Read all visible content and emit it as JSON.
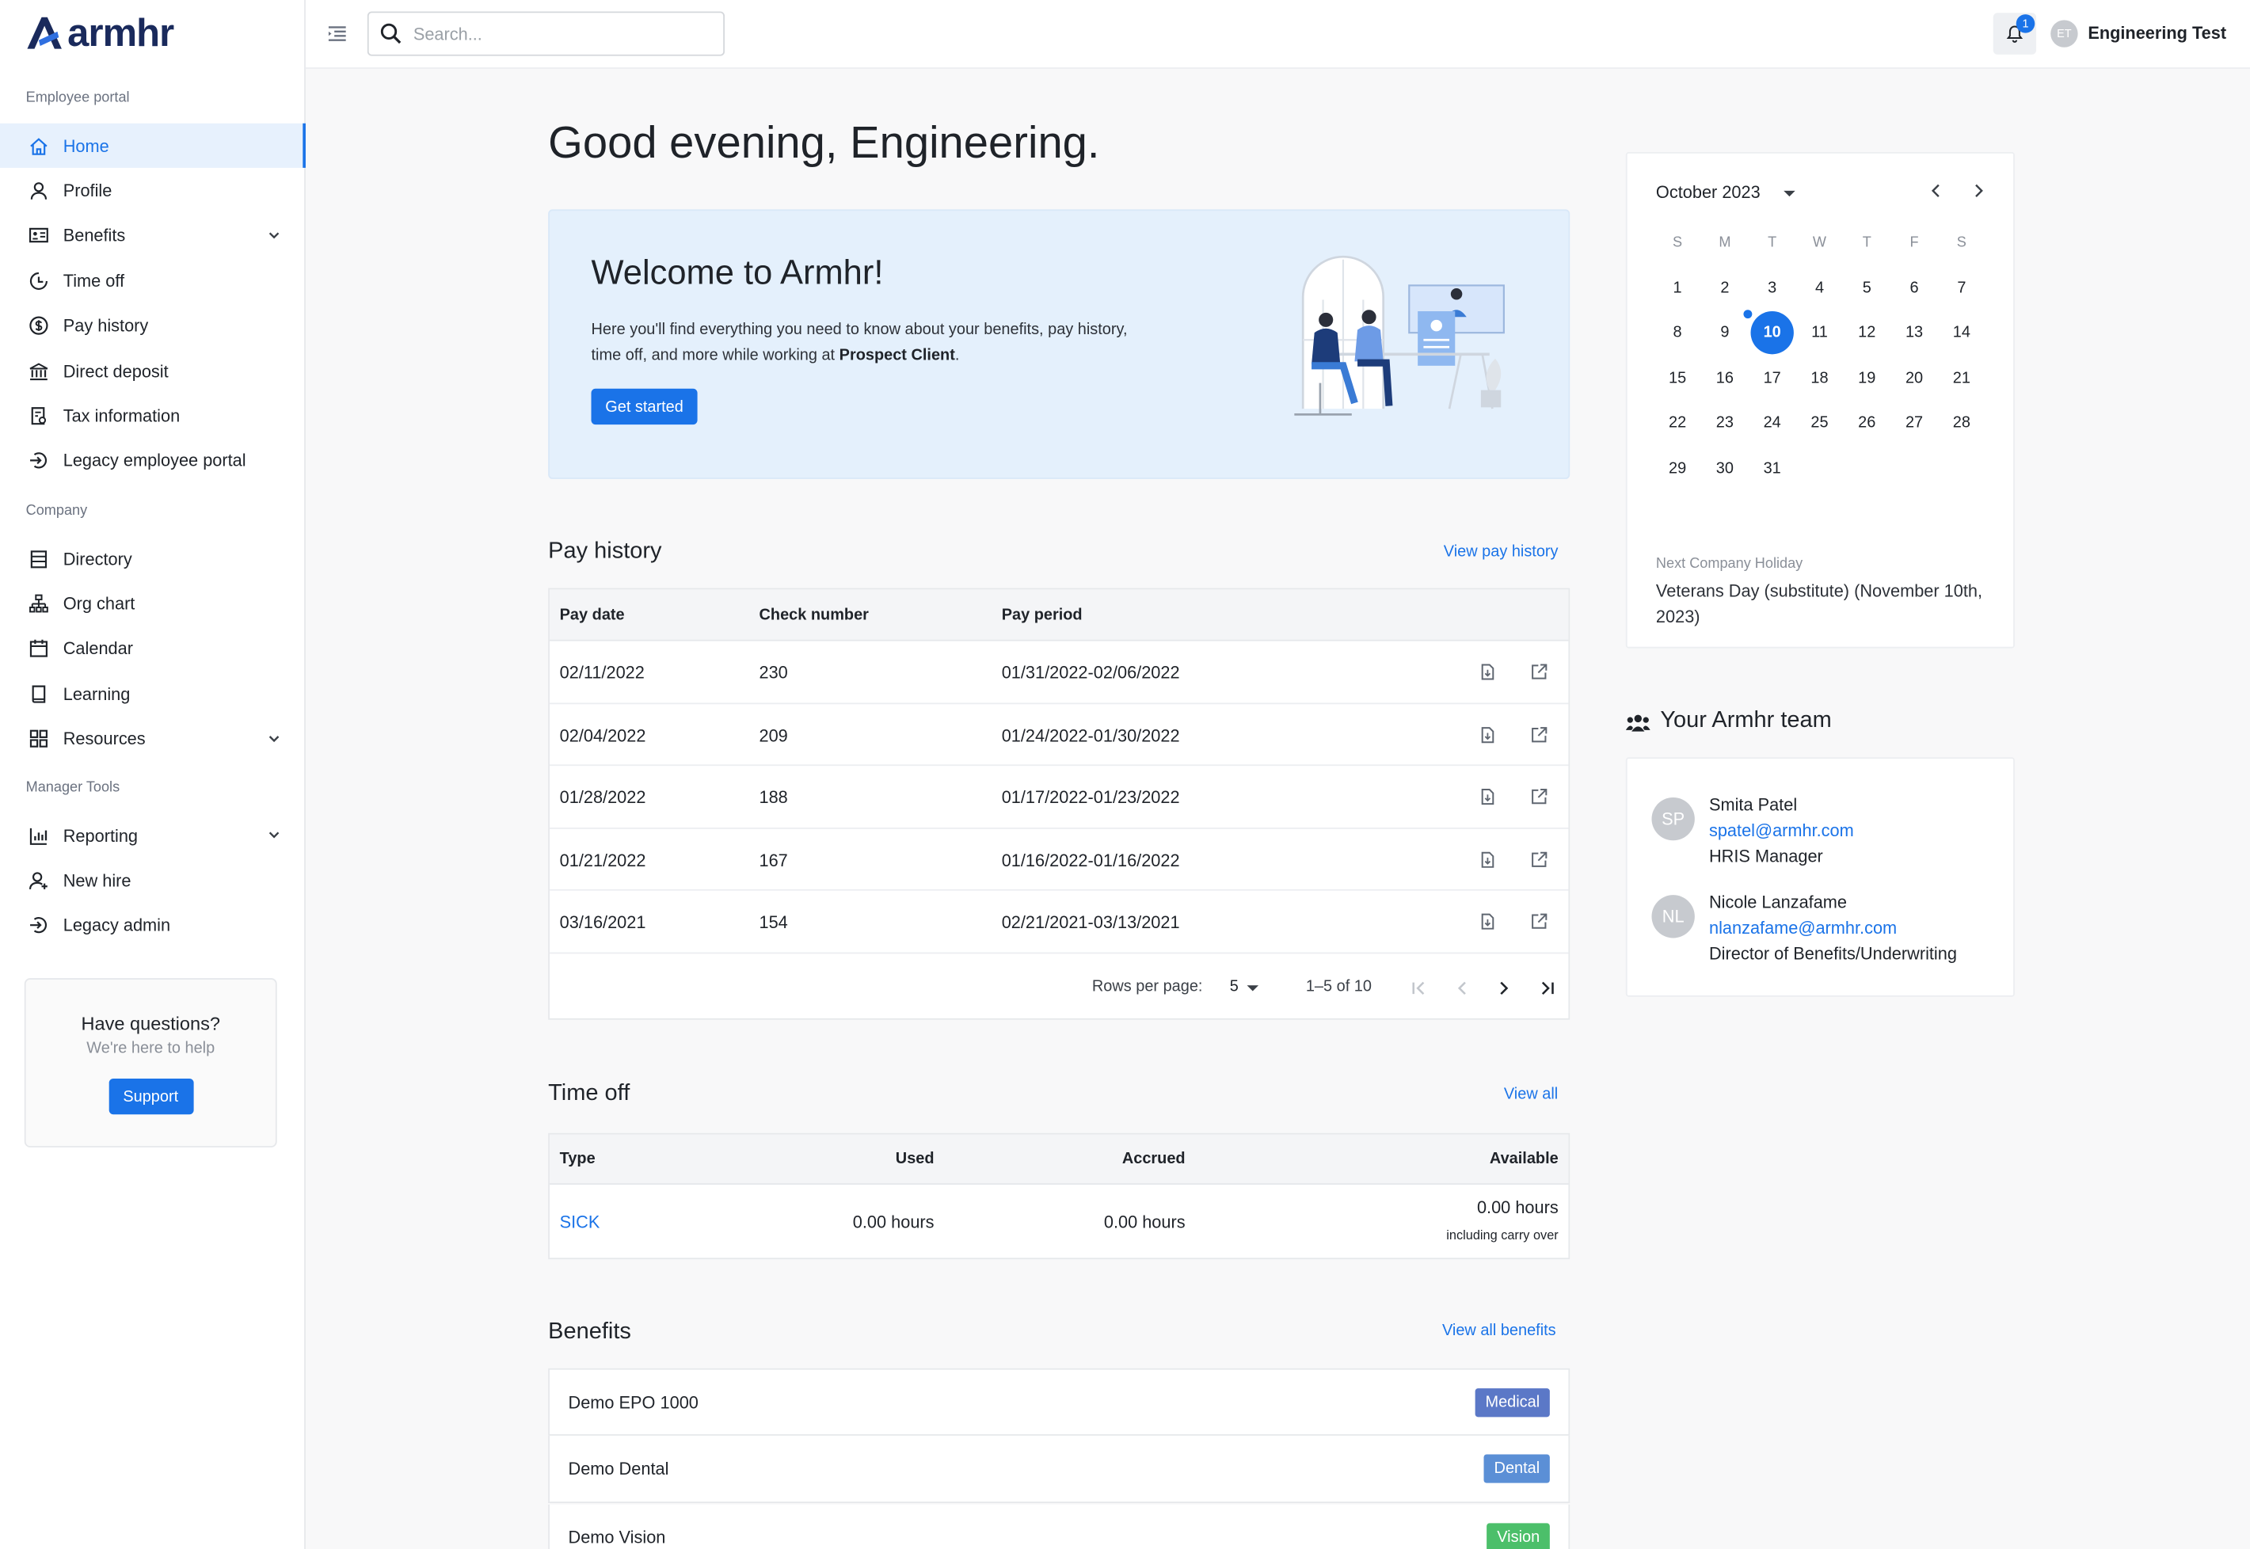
{
  "brand": {
    "name": "armhr"
  },
  "sidebar": {
    "sections": [
      "Employee portal",
      "Company",
      "Manager Tools"
    ],
    "employee_items": [
      {
        "label": "Home",
        "icon": "home-icon"
      },
      {
        "label": "Profile",
        "icon": "user-icon"
      },
      {
        "label": "Benefits",
        "icon": "id-card-icon"
      },
      {
        "label": "Time off",
        "icon": "clock-icon"
      },
      {
        "label": "Pay history",
        "icon": "dollar-icon"
      },
      {
        "label": "Direct deposit",
        "icon": "bank-icon"
      },
      {
        "label": "Tax information",
        "icon": "receipt-icon"
      },
      {
        "label": "Legacy employee portal",
        "icon": "login-icon"
      }
    ],
    "company_items": [
      {
        "label": "Directory",
        "icon": "list-icon"
      },
      {
        "label": "Org chart",
        "icon": "org-chart-icon"
      },
      {
        "label": "Calendar",
        "icon": "calendar-icon"
      },
      {
        "label": "Learning",
        "icon": "book-icon"
      },
      {
        "label": "Resources",
        "icon": "grid-icon"
      }
    ],
    "manager_items": [
      {
        "label": "Reporting",
        "icon": "bar-chart-icon"
      },
      {
        "label": "New hire",
        "icon": "user-add-icon"
      },
      {
        "label": "Legacy admin",
        "icon": "login-icon"
      }
    ],
    "help": {
      "title": "Have questions?",
      "subtitle": "We're here to help",
      "button": "Support"
    }
  },
  "topbar": {
    "search_placeholder": "Search...",
    "notification_count": "1",
    "user_initials": "ET",
    "user_name": "Engineering Test"
  },
  "main": {
    "greeting": "Good evening, Engineering.",
    "welcome": {
      "title": "Welcome to Armhr!",
      "text_prefix": "Here you'll find everything you need to know about your benefits, pay history, time off, and more while working at ",
      "client": "Prospect Client",
      "text_suffix": ".",
      "button": "Get started"
    },
    "pay_history": {
      "title": "Pay history",
      "link": "View pay history",
      "columns": [
        "Pay date",
        "Check number",
        "Pay period"
      ],
      "rows": [
        {
          "date": "02/11/2022",
          "check": "230",
          "period": "01/31/2022-02/06/2022"
        },
        {
          "date": "02/04/2022",
          "check": "209",
          "period": "01/24/2022-01/30/2022"
        },
        {
          "date": "01/28/2022",
          "check": "188",
          "period": "01/17/2022-01/23/2022"
        },
        {
          "date": "01/21/2022",
          "check": "167",
          "period": "01/16/2022-01/16/2022"
        },
        {
          "date": "03/16/2021",
          "check": "154",
          "period": "02/21/2021-03/13/2021"
        }
      ],
      "rows_per_page_label": "Rows per page:",
      "rows_per_page": "5",
      "range": "1–5 of 10"
    },
    "time_off": {
      "title": "Time off",
      "link": "View all",
      "columns": [
        "Type",
        "Used",
        "Accrued",
        "Available"
      ],
      "row": {
        "type": "SICK",
        "used": "0.00 hours",
        "accrued": "0.00 hours",
        "available": "0.00 hours",
        "note": "including carry over"
      }
    },
    "benefits": {
      "title": "Benefits",
      "link": "View all benefits",
      "items": [
        {
          "name": "Demo EPO 1000",
          "tag": "Medical",
          "color": "#5b78c7"
        },
        {
          "name": "Demo Dental",
          "tag": "Dental",
          "color": "#5b8fd6"
        },
        {
          "name": "Demo Vision",
          "tag": "Vision",
          "color": "#4cbf6a"
        }
      ]
    }
  },
  "calendar": {
    "month": "October 2023",
    "weekdays": [
      "S",
      "M",
      "T",
      "W",
      "T",
      "F",
      "S"
    ],
    "start_offset": 0,
    "days_in_month": 31,
    "selected_day": 10,
    "holiday_day": 10,
    "holiday_label": "Next Company Holiday",
    "holiday_name": "Veterans Day (substitute) (November 10th, 2023)"
  },
  "team": {
    "title": "Your Armhr team",
    "members": [
      {
        "initials": "SP",
        "name": "Smita Patel",
        "email": "spatel@armhr.com",
        "role": "HRIS Manager"
      },
      {
        "initials": "NL",
        "name": "Nicole Lanzafame",
        "email": "nlanzafame@armhr.com",
        "role": "Director of Benefits/Underwriting"
      }
    ]
  },
  "colors": {
    "accent": "#1a73e8",
    "active_bg": "#e7f1fd",
    "welcome_bg": "#e4f0fc"
  }
}
